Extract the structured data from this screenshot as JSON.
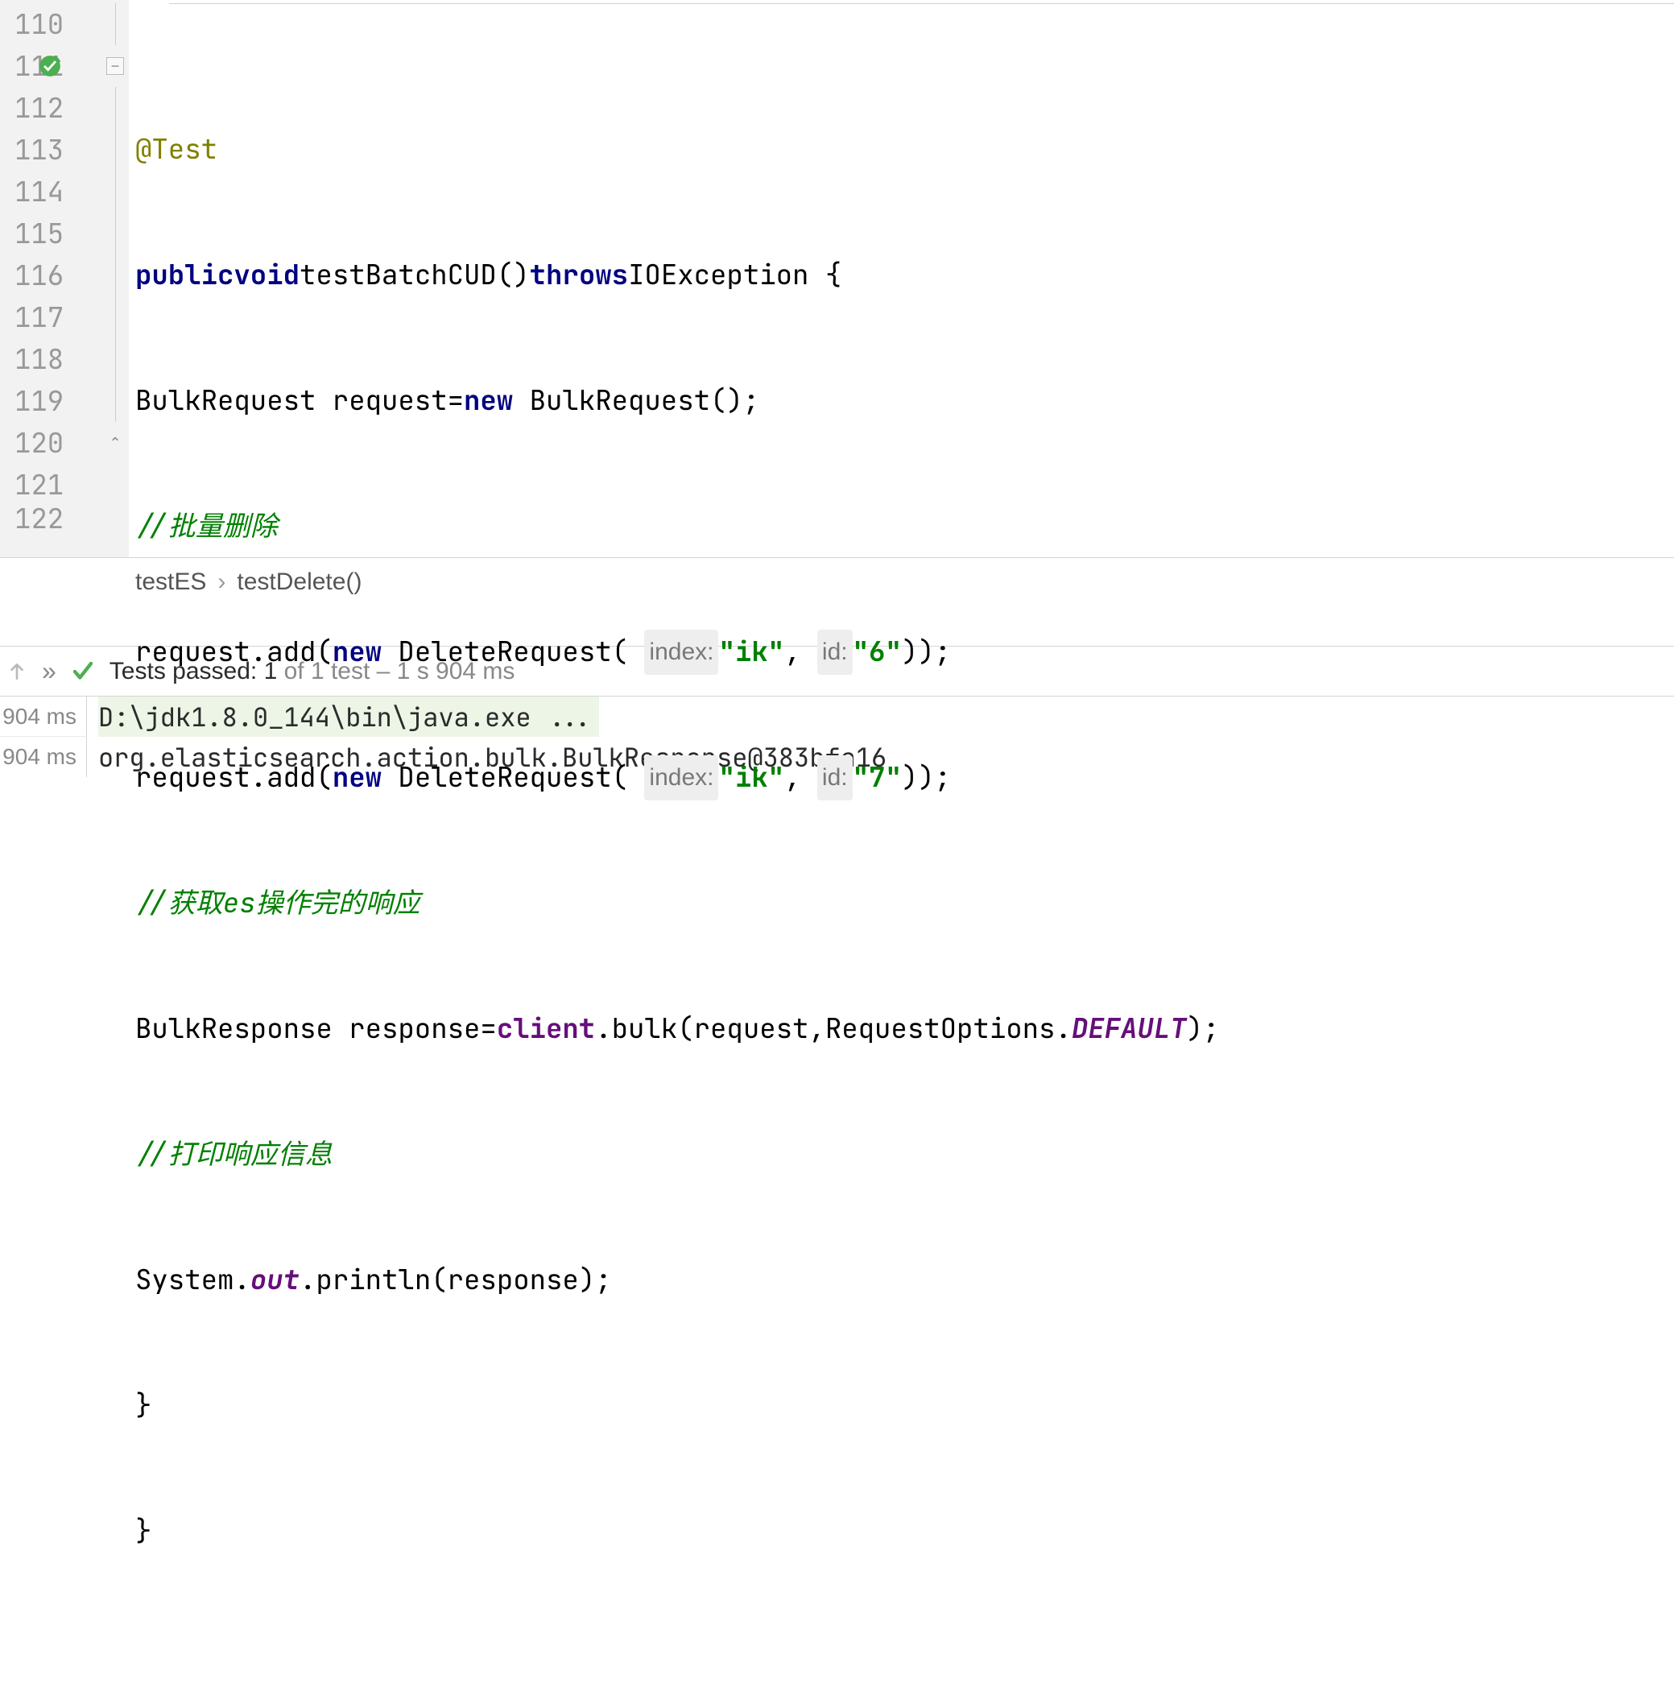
{
  "editor": {
    "lines": {
      "110": "110",
      "111": "111",
      "112": "112",
      "113": "113",
      "114": "114",
      "115": "115",
      "116": "116",
      "117": "117",
      "118": "118",
      "119": "119",
      "120": "120",
      "121": "121",
      "122": "122"
    },
    "code": {
      "annotation": "@Test",
      "kw_public": "public",
      "kw_void": "void",
      "method_name": "testBatchCUD()",
      "kw_throws": "throws",
      "throws_type": "IOException {",
      "l112_a": "BulkRequest request=",
      "kw_new1": "new",
      "l112_b": " BulkRequest();",
      "comment1": "//批量删除",
      "l114_a": "request.add(",
      "kw_new2": "new",
      "l114_b": " DeleteRequest( ",
      "hint_index1": "index:",
      "str_ik1": "\"ik\"",
      "l114_c": ", ",
      "hint_id1": "id:",
      "str_6": "\"6\"",
      "l114_d": "));",
      "l115_a": "request.add(",
      "kw_new3": "new",
      "l115_b": " DeleteRequest( ",
      "hint_index2": "index:",
      "str_ik2": "\"ik\"",
      "l115_c": ", ",
      "hint_id2": "id:",
      "str_7": "\"7\"",
      "l115_d": "));",
      "comment2": "//获取es操作完的响应",
      "l117_a": "BulkResponse response=",
      "field_client": "client",
      "l117_b": ".bulk(request,RequestOptions.",
      "field_default": "DEFAULT",
      "l117_c": ");",
      "comment3": "//打印响应信息",
      "l119_a": "System.",
      "field_out": "out",
      "l119_b": ".println(response);",
      "l120": "}",
      "l121": "}"
    }
  },
  "breadcrumb": {
    "class": "testES",
    "method": "testDelete()"
  },
  "tests": {
    "label_passed": "Tests passed: ",
    "count": "1",
    "rest": " of 1 test – 1 s 904 ms"
  },
  "times": {
    "t1": "904 ms",
    "t2": "904 ms"
  },
  "console": {
    "line1": "D:\\jdk1.8.0_144\\bin\\java.exe ...",
    "line2": "org.elasticsearch.action.bulk.BulkResponse@383bfa16"
  }
}
